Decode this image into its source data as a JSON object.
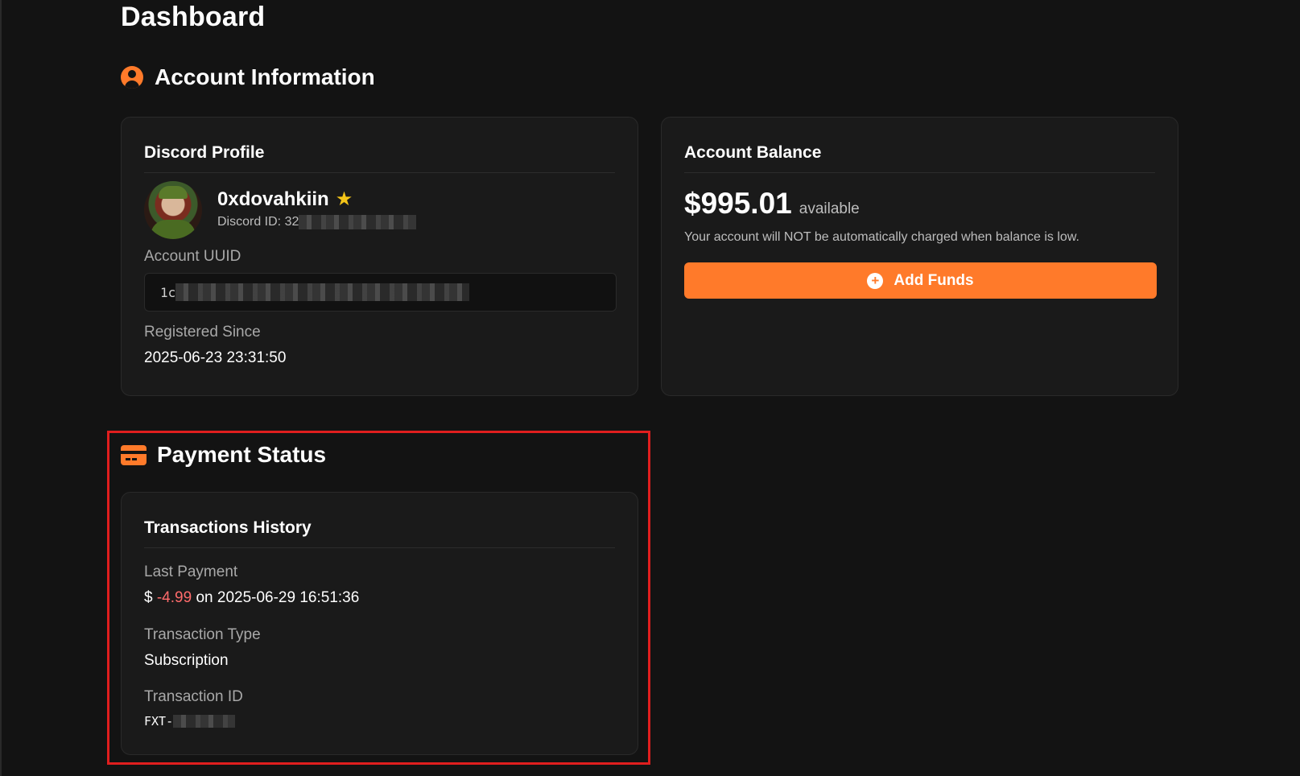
{
  "page": {
    "title": "Dashboard"
  },
  "account_section": {
    "heading": "Account Information",
    "icon": "user-circle-icon"
  },
  "discord_profile": {
    "title": "Discord Profile",
    "username": "0xdovahkiin",
    "badge_icon": "star-icon",
    "discord_id_label": "Discord ID: 32",
    "uuid_label": "Account UUID",
    "uuid_value": "1c",
    "registered_label": "Registered Since",
    "registered_value": "2025-06-23 23:31:50"
  },
  "balance": {
    "title": "Account Balance",
    "amount": "$995.01",
    "available_label": "available",
    "note": "Your account will NOT be automatically charged when balance is low.",
    "add_funds_label": "Add Funds"
  },
  "payment_section": {
    "heading": "Payment Status",
    "icon": "credit-card-icon"
  },
  "transactions": {
    "title": "Transactions History",
    "last_payment_label": "Last Payment",
    "currency": "$",
    "amount": "-4.99",
    "on_label": "on",
    "date": "2025-06-29 16:51:36",
    "type_label": "Transaction Type",
    "type_value": "Subscription",
    "id_label": "Transaction ID",
    "id_prefix": "FXT-"
  },
  "colors": {
    "accent": "#ff7a2a",
    "negative": "#ff6b6b",
    "highlight": "#e01e1e",
    "background": "#131313",
    "card": "#1a1a1a"
  }
}
